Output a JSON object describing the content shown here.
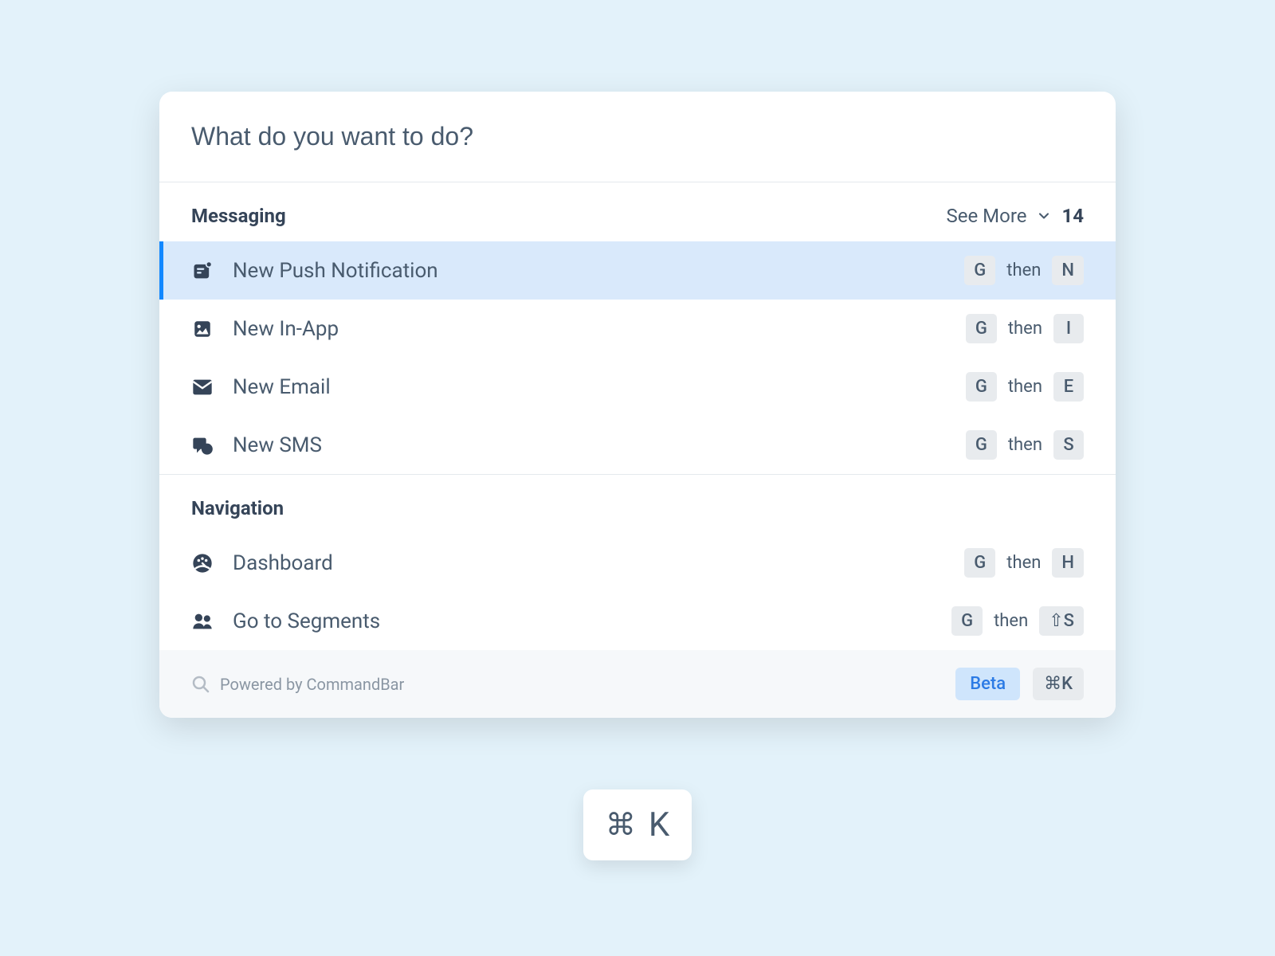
{
  "search": {
    "placeholder": "What do you want to do?"
  },
  "sections": {
    "messaging": {
      "title": "Messaging",
      "see_more": "See More",
      "count": "14",
      "items": [
        {
          "label": "New Push Notification",
          "key1": "G",
          "then": "then",
          "key2": "N"
        },
        {
          "label": "New In-App",
          "key1": "G",
          "then": "then",
          "key2": "I"
        },
        {
          "label": "New Email",
          "key1": "G",
          "then": "then",
          "key2": "E"
        },
        {
          "label": "New SMS",
          "key1": "G",
          "then": "then",
          "key2": "S"
        }
      ]
    },
    "navigation": {
      "title": "Navigation",
      "items": [
        {
          "label": "Dashboard",
          "key1": "G",
          "then": "then",
          "key2": "H"
        },
        {
          "label": "Go to Segments",
          "key1": "G",
          "then": "then",
          "key2": "⇧S"
        }
      ]
    }
  },
  "footer": {
    "powered_by": "Powered by CommandBar",
    "beta": "Beta",
    "shortcut": "⌘K"
  },
  "hint": {
    "cmd": "⌘",
    "key": "K"
  }
}
